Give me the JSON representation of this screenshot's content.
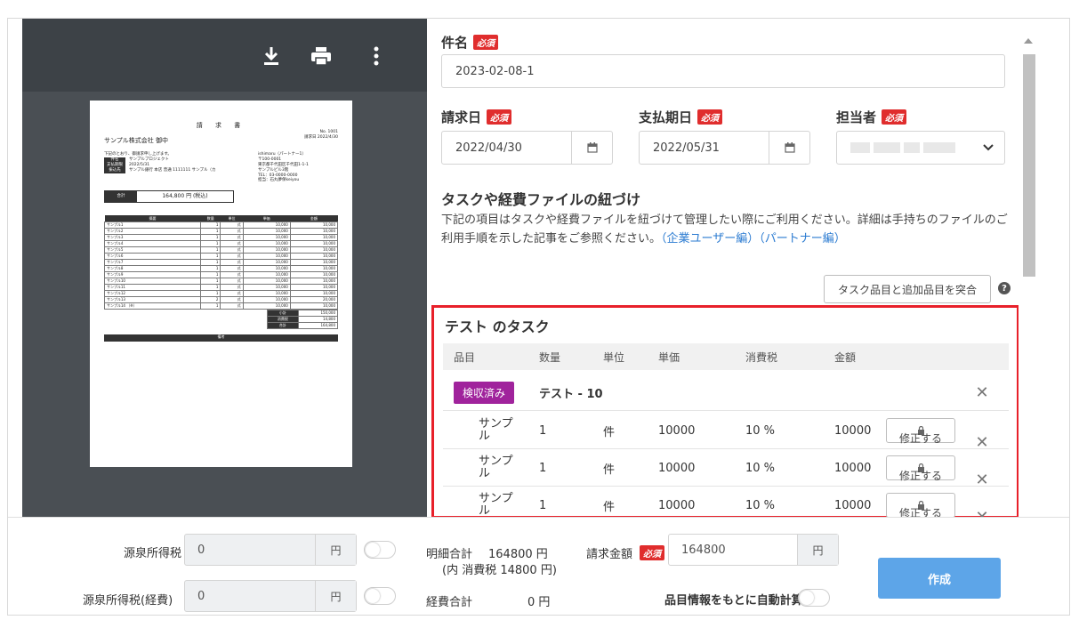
{
  "viewer": {
    "toolbar": {
      "download": "download-icon",
      "print": "print-icon",
      "more": "more-vert-icon"
    },
    "pdf": {
      "title": "請 求 書",
      "recipient": "サンプル株式会社 御中",
      "no_label": "No.",
      "no_value": "1001",
      "date_label": "請求日",
      "date_value": "2022/4/30",
      "intro": "下記のとおり、御請求申し上げます。",
      "fields": [
        {
          "k": "件名",
          "v": "サンプルプロジェクト"
        },
        {
          "k": "支払期限",
          "v": "2022/5/31"
        },
        {
          "k": "振込先",
          "v": "サンプル銀行 本店 普通 1111111 サンプル（カ"
        }
      ],
      "issuer": [
        "ishimaru（パートナー1）",
        "〒100-0001",
        "東京都千代田区千代田1-1-1",
        "サンプルビル3階",
        "TEL：03-0000-0000",
        "担当：石丸夢保keiyou"
      ],
      "total_label": "合計",
      "total_value": "164,800 円 (税込)",
      "table_headers": [
        "摘要",
        "数量",
        "単位",
        "単価",
        "金額"
      ],
      "table_rows": [
        [
          "サンプル1",
          "1",
          "式",
          "10,000",
          "10,000"
        ],
        [
          "サンプル2",
          "1",
          "式",
          "10,000",
          "10,000"
        ],
        [
          "サンプル3",
          "1",
          "式",
          "10,000",
          "10,000"
        ],
        [
          "サンプル4",
          "1",
          "式",
          "10,000",
          "10,000"
        ],
        [
          "サンプル5",
          "1",
          "式",
          "10,000",
          "10,000"
        ],
        [
          "サンプル6",
          "1",
          "式",
          "10,000",
          "10,000"
        ],
        [
          "サンプル7",
          "1",
          "式",
          "10,000",
          "10,000"
        ],
        [
          "サンプル8",
          "1",
          "式",
          "10,000",
          "10,000"
        ],
        [
          "サンプル9",
          "1",
          "式",
          "10,000",
          "10,000"
        ],
        [
          "サンプル10",
          "1",
          "式",
          "10,000",
          "10,000"
        ],
        [
          "サンプル11",
          "1",
          "式",
          "10,000",
          "10,000"
        ],
        [
          "サンプル12",
          "1",
          "式",
          "10,000",
          "10,000"
        ],
        [
          "サンプル13",
          "2",
          "式",
          "10,000",
          "20,000"
        ],
        [
          "サンプル14 （※）",
          "1",
          "式",
          "10,000",
          "10,000"
        ]
      ],
      "summary": [
        {
          "k": "小計",
          "v": "150,000"
        },
        {
          "k": "消費税",
          "v": "14,800"
        },
        {
          "k": "合計",
          "v": "164,800"
        }
      ],
      "note_label": "備考"
    }
  },
  "form": {
    "subject": {
      "label": "件名",
      "required": "必須",
      "value": "2023-02-08-1"
    },
    "invoice_date": {
      "label": "請求日",
      "required": "必須",
      "value": "2022/04/30"
    },
    "due_date": {
      "label": "支払期日",
      "required": "必須",
      "value": "2022/05/31"
    },
    "assignee": {
      "label": "担当者",
      "required": "必須"
    },
    "link_section": {
      "title": "タスクや経費ファイルの紐づけ",
      "desc": "下記の項目はタスクや経費ファイルを紐づけて管理したい際にご利用ください。詳細は手持ちのファイルのご利用手順を示した記事をご参照ください。",
      "link1": "（企業ユーザー編）",
      "link2": "（パートナー編）"
    },
    "compare_button": "タスク品目と追加品目を突合",
    "task": {
      "title": "テスト のタスク",
      "headers": [
        "品目",
        "数量",
        "単位",
        "単価",
        "消費税",
        "金額"
      ],
      "badge": "検収済み",
      "group_name": "テスト - 10",
      "edit_label": "修正する",
      "rows": [
        {
          "name": "サンプル",
          "qty": "1",
          "unit": "件",
          "price": "10000",
          "tax": "10 %",
          "amount": "10000"
        },
        {
          "name": "サンプル",
          "qty": "1",
          "unit": "件",
          "price": "10000",
          "tax": "10 %",
          "amount": "10000"
        },
        {
          "name": "サンプル",
          "qty": "1",
          "unit": "件",
          "price": "10000",
          "tax": "10 %",
          "amount": "10000"
        }
      ]
    }
  },
  "footer": {
    "withholding": {
      "label": "源泉所得税",
      "value": "0",
      "unit": "円"
    },
    "withholding_expense": {
      "label": "源泉所得税(経費)",
      "value": "0",
      "unit": "円"
    },
    "detail_total_label": "明細合計",
    "detail_total_value": "164800 円",
    "detail_tax": "(内 消費税 14800 円)",
    "expense_total_label": "経費合計",
    "expense_total_value": "0 円",
    "invoice_amount": {
      "label": "請求金額",
      "required": "必須",
      "value": "164800",
      "unit": "円"
    },
    "auto_calc_label": "品目情報をもとに自動計算",
    "create_button": "作成"
  }
}
